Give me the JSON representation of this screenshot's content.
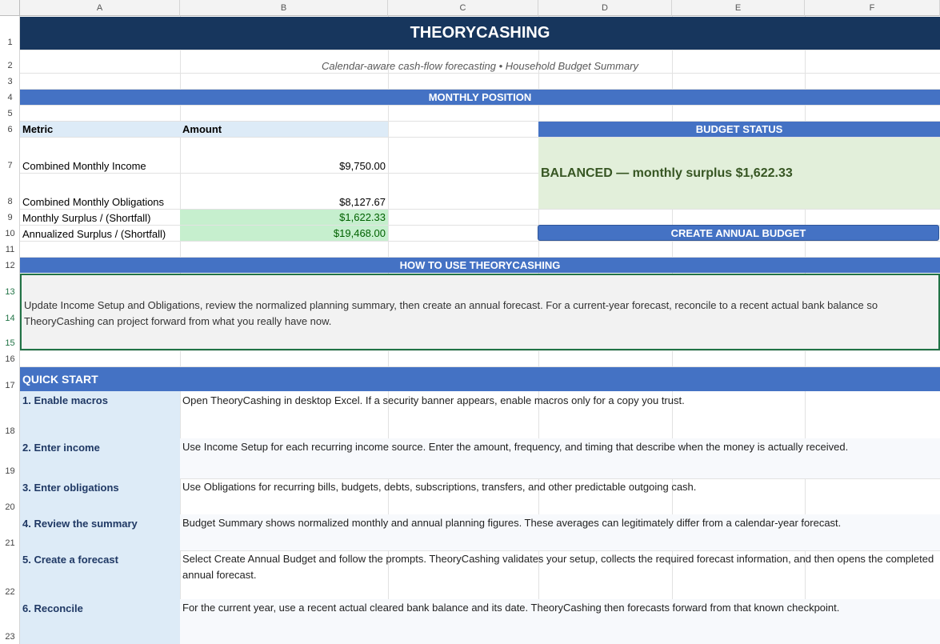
{
  "columns": [
    "A",
    "B",
    "C",
    "D",
    "E",
    "F"
  ],
  "rows": [
    "1",
    "2",
    "3",
    "4",
    "5",
    "6",
    "7",
    "8",
    "9",
    "10",
    "11",
    "12",
    "13",
    "14",
    "15",
    "16",
    "17",
    "18",
    "19",
    "20",
    "21",
    "22",
    "23"
  ],
  "title": "THEORYCASHING",
  "subtitle": "Calendar-aware cash-flow forecasting • Household Budget Summary",
  "monthly_position": {
    "header": "MONTHLY POSITION",
    "metric_label": "Metric",
    "amount_label": "Amount",
    "items": [
      {
        "label": "Combined Monthly Income",
        "value": "$9,750.00"
      },
      {
        "label": "Combined Monthly Obligations",
        "value": "$8,127.67"
      },
      {
        "label": "Monthly Surplus / (Shortfall)",
        "value": "$1,622.33"
      },
      {
        "label": "Annualized Surplus / (Shortfall)",
        "value": "$19,468.00"
      }
    ]
  },
  "budget_status": {
    "header": "BUDGET STATUS",
    "text": "BALANCED — monthly surplus $1,622.33",
    "button_label": "CREATE ANNUAL BUDGET"
  },
  "how_to": {
    "header": "HOW TO USE THEORYCASHING",
    "text": "Update Income Setup and Obligations, review the normalized planning summary, then create an annual forecast. For a current-year forecast, reconcile to a recent actual bank balance so TheoryCashing can project forward from what you really have now."
  },
  "quick_start": {
    "header": "QUICK START",
    "steps": [
      {
        "step": "1. Enable macros",
        "desc": "Open TheoryCashing in desktop Excel. If a security banner appears, enable macros only for a copy you trust."
      },
      {
        "step": "2. Enter income",
        "desc": "Use Income Setup for each recurring income source. Enter the amount, frequency, and timing that describe when the money is actually received."
      },
      {
        "step": "3. Enter obligations",
        "desc": "Use Obligations for recurring bills, budgets, debts, subscriptions, transfers, and other predictable outgoing cash."
      },
      {
        "step": "4. Review the summary",
        "desc": "Budget Summary shows normalized monthly and annual planning figures. These averages can legitimately differ from a calendar-year forecast."
      },
      {
        "step": "5. Create a forecast",
        "desc": "Select Create Annual Budget and follow the prompts. TheoryCashing validates your setup, collects the required forecast information, and then opens the completed annual forecast."
      },
      {
        "step": "6. Reconcile",
        "desc": "For the current year, use a recent actual cleared bank balance and its date. TheoryCashing then forecasts forward from that known checkpoint."
      }
    ]
  },
  "colors": {
    "dark_band": "#17365d",
    "blue_band": "#4472c4",
    "light_blue": "#ddebf7",
    "green_fill": "#c6efce",
    "status_fill": "#e2efda",
    "status_text": "#375623",
    "gray_fill": "#f2f2f2"
  }
}
